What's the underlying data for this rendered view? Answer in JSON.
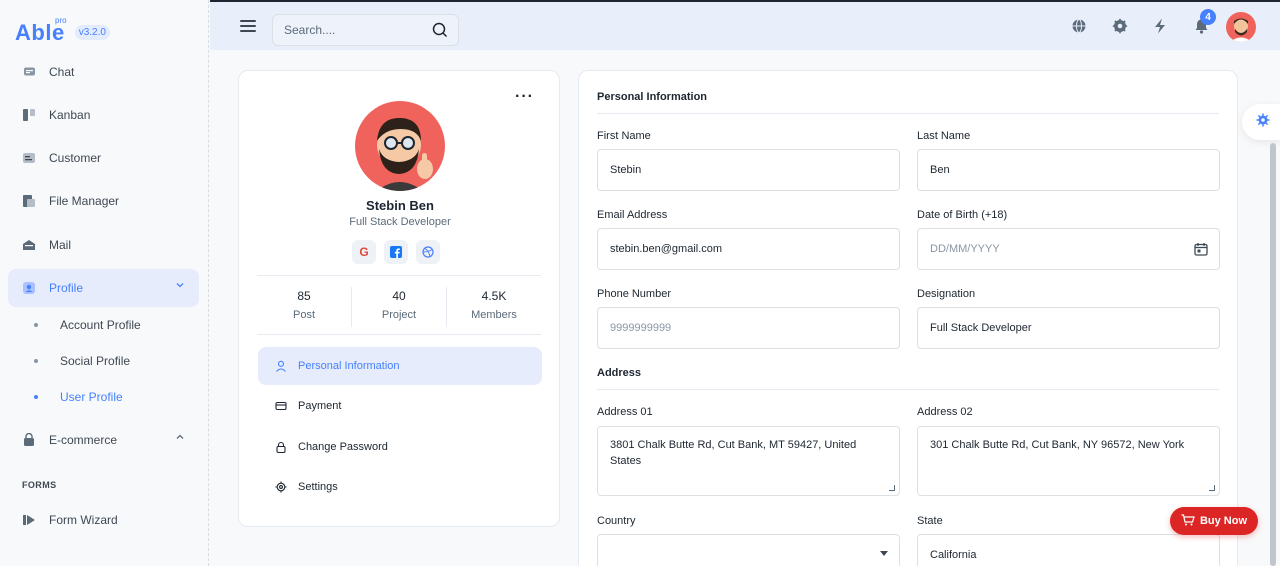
{
  "brand": {
    "name": "Able",
    "pro": "pro",
    "version": "v3.2.0"
  },
  "colors": {
    "accent": "#4680ff",
    "danger": "#dc2626",
    "avatar_bg": "#f0635d"
  },
  "sidebar": {
    "items": [
      {
        "label": "Chat",
        "icon": "chat-icon"
      },
      {
        "label": "Kanban",
        "icon": "kanban-icon"
      },
      {
        "label": "Customer",
        "icon": "customer-icon"
      },
      {
        "label": "File Manager",
        "icon": "file-manager-icon"
      },
      {
        "label": "Mail",
        "icon": "mail-icon"
      },
      {
        "label": "Profile",
        "icon": "profile-icon",
        "expanded": true
      },
      {
        "label": "E-commerce",
        "icon": "shop-icon"
      },
      {
        "label": "Form Wizard",
        "icon": "form-wizard-icon"
      }
    ],
    "profile_subitems": [
      "Account Profile",
      "Social Profile",
      "User Profile"
    ],
    "section_forms": "FORMS"
  },
  "header": {
    "search_placeholder": "Search....",
    "notification_count": "4",
    "icons": [
      "globe-icon",
      "settings-icon",
      "lightning-icon",
      "bell-icon"
    ]
  },
  "profile": {
    "name": "Stebin Ben",
    "role": "Full Stack Developer",
    "socials": [
      "google-icon",
      "facebook-icon",
      "dribbble-icon"
    ],
    "stats": [
      {
        "value": "85",
        "label": "Post"
      },
      {
        "value": "40",
        "label": "Project"
      },
      {
        "value": "4.5K",
        "label": "Members"
      }
    ],
    "menu": [
      {
        "label": "Personal Information",
        "icon": "user-icon"
      },
      {
        "label": "Payment",
        "icon": "card-icon"
      },
      {
        "label": "Change Password",
        "icon": "lock-icon"
      },
      {
        "label": "Settings",
        "icon": "settings-icon"
      }
    ]
  },
  "form": {
    "section_personal": "Personal Information",
    "section_address": "Address",
    "first_name_label": "First Name",
    "first_name": "Stebin",
    "last_name_label": "Last Name",
    "last_name": "Ben",
    "email_label": "Email Address",
    "email": "stebin.ben@gmail.com",
    "dob_label": "Date of Birth (+18)",
    "dob_placeholder": "DD/MM/YYYY",
    "phone_label": "Phone Number",
    "phone_placeholder": "9999999999",
    "designation_label": "Designation",
    "designation": "Full Stack Developer",
    "address1_label": "Address 01",
    "address1": "3801 Chalk Butte Rd, Cut Bank, MT 59427, United States",
    "address2_label": "Address 02",
    "address2": "301 Chalk Butte Rd, Cut Bank, NY 96572, New York",
    "country_label": "Country",
    "country": "",
    "state_label": "State",
    "state": "California"
  },
  "buy_now": "Buy Now"
}
